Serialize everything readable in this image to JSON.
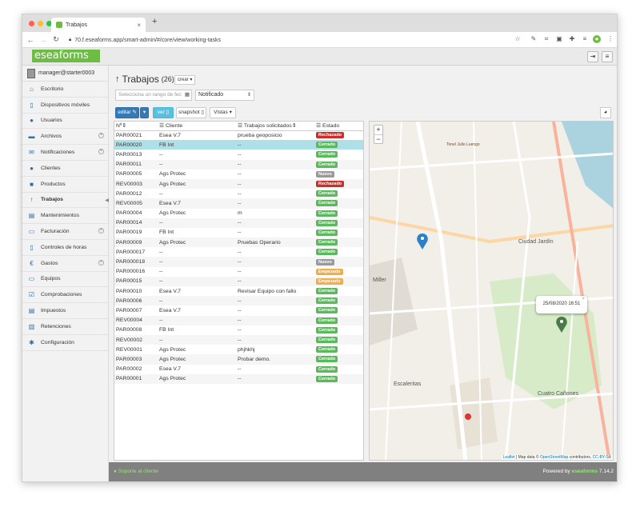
{
  "browser": {
    "tab_title": "Trabajos",
    "url": "70.f.eseaforms.app/smart-admin/#/core/view/working-tasks"
  },
  "app": {
    "logo": "eseaforms"
  },
  "sidebar": {
    "user": "manager@starter0003",
    "items": [
      {
        "label": "Escritorio",
        "icon": "home-icon",
        "glyph": "⌂"
      },
      {
        "label": "Dispositivos móviles",
        "icon": "mobile-icon",
        "glyph": "▯"
      },
      {
        "label": "Usuarios",
        "icon": "user-icon",
        "glyph": "●"
      },
      {
        "label": "Archivos",
        "icon": "folder-icon",
        "glyph": "▬",
        "plus": true
      },
      {
        "label": "Notificaciones",
        "icon": "envelope-icon",
        "glyph": "✉",
        "plus": true
      },
      {
        "label": "Clientes",
        "icon": "users-icon",
        "glyph": "●"
      },
      {
        "label": "Productos",
        "icon": "cube-icon",
        "glyph": "■"
      },
      {
        "label": "Trabajos",
        "icon": "tasks-icon",
        "glyph": "↑",
        "active": true
      },
      {
        "label": "Mantenimientos",
        "icon": "wrench-icon",
        "glyph": "▤"
      },
      {
        "label": "Facturación",
        "icon": "invoice-icon",
        "glyph": "▭",
        "plus": true
      },
      {
        "label": "Controles de horas",
        "icon": "clock-icon",
        "glyph": "▯"
      },
      {
        "label": "Gastos",
        "icon": "euro-icon",
        "glyph": "€",
        "plus": true
      },
      {
        "label": "Equipos",
        "icon": "device-icon",
        "glyph": "▭"
      },
      {
        "label": "Comprobaciones",
        "icon": "check-icon",
        "glyph": "☑"
      },
      {
        "label": "Impuestos",
        "icon": "tax-icon",
        "glyph": "▤"
      },
      {
        "label": "Retenciones",
        "icon": "bank-icon",
        "glyph": "▥"
      },
      {
        "label": "Configuración",
        "icon": "gear-icon",
        "glyph": "✱"
      }
    ]
  },
  "main": {
    "title": "Trabajos",
    "count": "(26)",
    "create_btn": "crear",
    "date_placeholder": "Selecciona un rango de fec",
    "filter_value": "Notificado",
    "buttons": {
      "edit": "editar",
      "view": "ver",
      "snapshot": "snapshot",
      "views": "Vistas"
    },
    "columns": {
      "num": "Nº",
      "client": "Cliente",
      "jobs": "Trabajos solicitados",
      "status": "Estado"
    }
  },
  "status_colors": {
    "Rechazado": "#c9302c",
    "Cerrado": "#5cb85c",
    "Nuevo": "#999999",
    "Empezado": "#f0ad4e"
  },
  "rows": [
    {
      "id": "PAR00021",
      "client": "Esea V.7",
      "job": "prueba geoposicio",
      "status": "Rechazado"
    },
    {
      "id": "PAR00020",
      "client": "FB Int",
      "job": "--",
      "status": "Cerrado",
      "selected": true
    },
    {
      "id": "PAR00013",
      "client": "--",
      "job": "--",
      "status": "Cerrado"
    },
    {
      "id": "PAR00011",
      "client": "--",
      "job": "--",
      "status": "Cerrado"
    },
    {
      "id": "PAR00005",
      "client": "Ags Protec",
      "job": "--",
      "status": "Nuevo"
    },
    {
      "id": "REV00003",
      "client": "Ags Protec",
      "job": "--",
      "status": "Rechazado"
    },
    {
      "id": "PAR00012",
      "client": "--",
      "job": "--",
      "status": "Cerrado"
    },
    {
      "id": "REV00005",
      "client": "Esea V.7",
      "job": "--",
      "status": "Cerrado"
    },
    {
      "id": "PAR00004",
      "client": "Ags Protec",
      "job": "m",
      "status": "Cerrado"
    },
    {
      "id": "PAR00014",
      "client": "--",
      "job": "--",
      "status": "Cerrado"
    },
    {
      "id": "PAR00019",
      "client": "FB Int",
      "job": "--",
      "status": "Cerrado"
    },
    {
      "id": "PAR00009",
      "client": "Ags Protec",
      "job": "Pruebas Operario",
      "status": "Cerrado"
    },
    {
      "id": "PAR000017",
      "client": "--",
      "job": "--",
      "status": "Cerrado"
    },
    {
      "id": "PAR000018",
      "client": "--",
      "job": "--",
      "status": "Nuevo"
    },
    {
      "id": "PAR000016",
      "client": "--",
      "job": "--",
      "status": "Empezado"
    },
    {
      "id": "PAR00015",
      "client": "--",
      "job": "--",
      "status": "Empezado"
    },
    {
      "id": "PAR00010",
      "client": "Esea V.7",
      "job": "Revisar Equipo con fallo",
      "status": "Cerrado"
    },
    {
      "id": "PAR00006",
      "client": "--",
      "job": "--",
      "status": "Cerrado"
    },
    {
      "id": "PAR00007",
      "client": "Esea V.7",
      "job": "--",
      "status": "Cerrado"
    },
    {
      "id": "REV00004",
      "client": "--",
      "job": "--",
      "status": "Cerrado"
    },
    {
      "id": "PAR00008",
      "client": "FB Int",
      "job": "--",
      "status": "Cerrado"
    },
    {
      "id": "REV00002",
      "client": "--",
      "job": "--",
      "status": "Cerrado"
    },
    {
      "id": "REV00001",
      "client": "Ags Protec",
      "job": "phjhkhj",
      "status": "Cerrado"
    },
    {
      "id": "PAR00003",
      "client": "Ags Protec",
      "job": "Probar demo.",
      "status": "Cerrado"
    },
    {
      "id": "PAR00002",
      "client": "Esea V.7",
      "job": "--",
      "status": "Cerrado"
    },
    {
      "id": "PAR00001",
      "client": "Ags Protec",
      "job": "--",
      "status": "Cerrado"
    }
  ],
  "map": {
    "popup_text": "25/08/2020 16:51",
    "attribution_leaflet": "Leaflet",
    "attribution_mid": "| Map data ©",
    "attribution_osm": "OpenStreetMap",
    "attribution_contrib": "contributors,",
    "attribution_license": "CC-BY-SA",
    "labels": [
      "Ciudad Jardín",
      "Escaleritas",
      "Cuatro Cañones",
      "Miller",
      "Tonel Julio Luengo"
    ]
  },
  "footer": {
    "support": "Soporte al cliente",
    "powered": "Powered by",
    "brand": "eseaforms",
    "version": "7.14.2"
  }
}
